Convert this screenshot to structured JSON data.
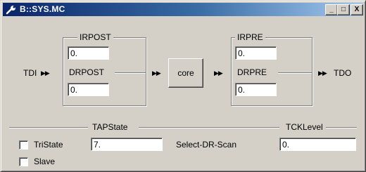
{
  "window": {
    "title": "B::SYS.MC"
  },
  "titlebar_buttons": {
    "minimize": "_",
    "maximize": "□",
    "close": "X"
  },
  "chain": {
    "tdi_label": "TDI",
    "tdo_label": "TDO",
    "arrow_glyph": "▶▶",
    "core_label": "core"
  },
  "pre_group": {
    "irpost_label": "IRPOST",
    "irpost_value": "0.",
    "drpost_label": "DRPOST",
    "drpost_value": "0."
  },
  "post_group": {
    "irpre_label": "IRPRE",
    "irpre_value": "0.",
    "drpre_label": "DRPRE",
    "drpre_value": "0."
  },
  "tapstate": {
    "label": "TAPState",
    "value": "7.",
    "state_name": "Select-DR-Scan"
  },
  "tcklevel": {
    "label": "TCKLevel",
    "value": "0."
  },
  "options": {
    "tristate_label": "TriState",
    "slave_label": "Slave",
    "tristate_checked": false,
    "slave_checked": false
  }
}
